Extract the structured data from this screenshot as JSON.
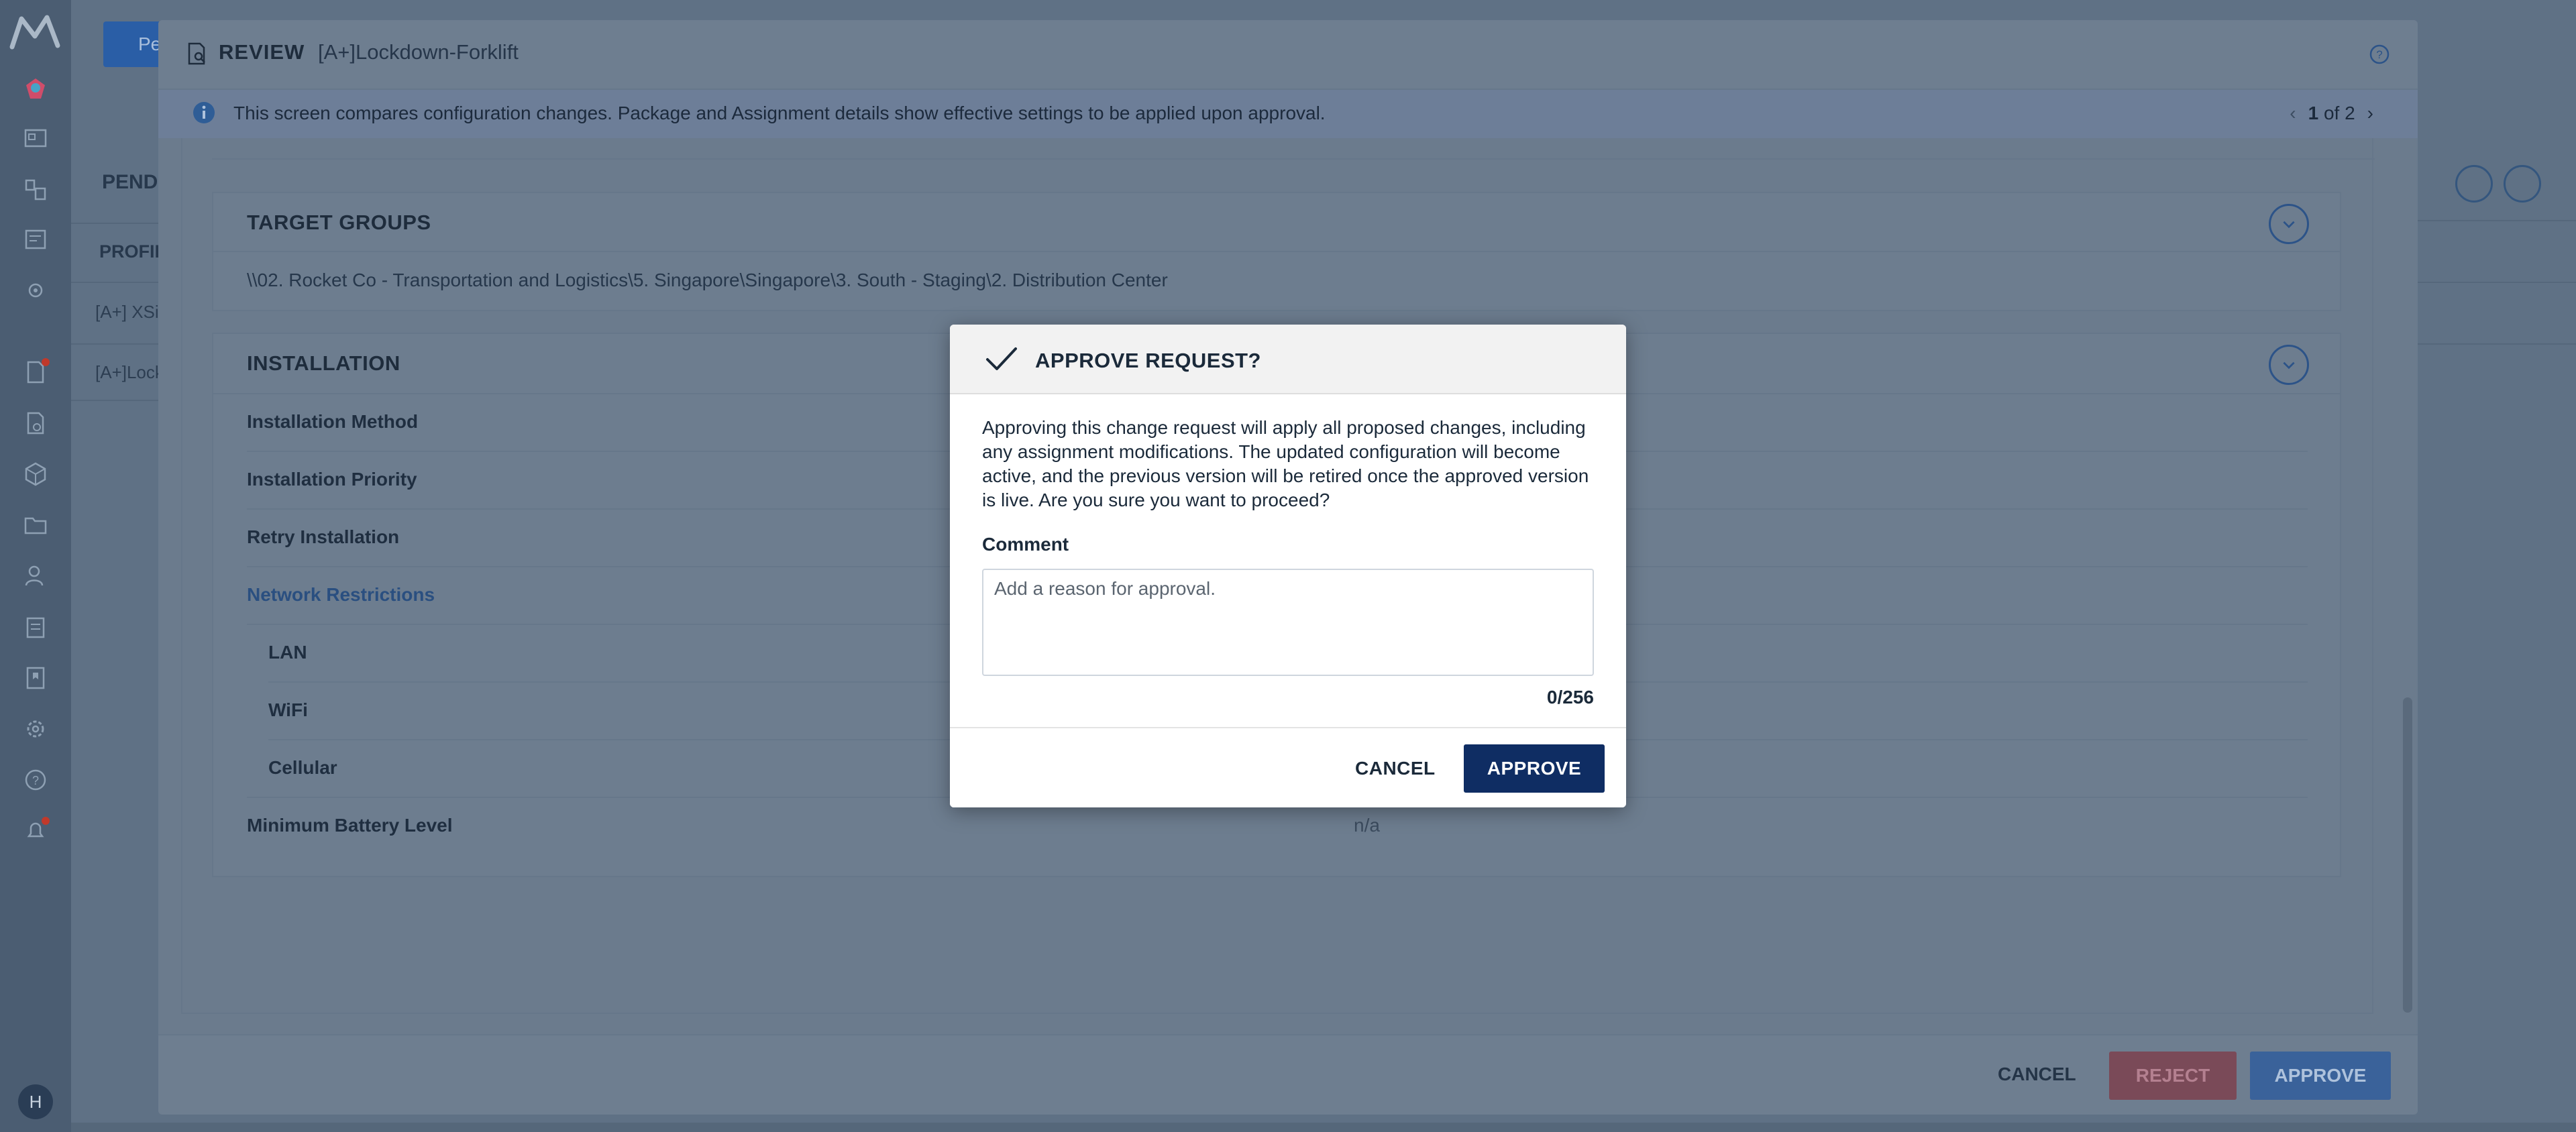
{
  "background": {
    "new_button_label": "Pe",
    "section_title": "PENDI",
    "column_header": "PROFIL",
    "rows": [
      "[A+] XSi",
      "[A+]Lock"
    ]
  },
  "review": {
    "title": "REVIEW",
    "name": "[A+]Lockdown-Forklift",
    "info_text": "This screen compares configuration changes. Package and Assignment details show effective settings to be applied upon approval.",
    "pager": {
      "current": "1",
      "of_label": "of 2"
    },
    "target_groups": {
      "title": "TARGET GROUPS",
      "path": "\\\\02. Rocket Co - Transportation and Logistics\\5. Singapore\\Singapore\\3. South - Staging\\2. Distribution Center"
    },
    "installation": {
      "title": "INSTALLATION",
      "rows": [
        {
          "label": "Installation Method"
        },
        {
          "label": "Installation Priority"
        },
        {
          "label": "Retry Installation"
        },
        {
          "label": "Network Restrictions"
        },
        {
          "label": "LAN"
        },
        {
          "label": "WiFi"
        },
        {
          "label": "Cellular"
        },
        {
          "label": "Minimum Battery Level",
          "value": "n/a"
        }
      ]
    },
    "footer": {
      "cancel": "CANCEL",
      "reject": "REJECT",
      "approve": "APPROVE"
    }
  },
  "dialog": {
    "title": "APPROVE REQUEST?",
    "message": "Approving this change request will apply all proposed changes, including any assignment modifications. The updated configuration will become active, and the previous version will be retired once the approved version is live. Are you sure you want to proceed?",
    "comment_label": "Comment",
    "comment_placeholder": "Add a reason for approval.",
    "comment_value": "",
    "char_count": "0/256",
    "cancel": "CANCEL",
    "approve": "APPROVE"
  },
  "nav": {
    "avatar_initial": "H",
    "icons": [
      "dashboard-icon",
      "devices-icon",
      "reports-icon",
      "settings-cog-icon",
      "alerts-doc-icon",
      "profiles-icon",
      "packages-icon",
      "folder-icon",
      "users-icon",
      "clipboard-icon",
      "bookmark-icon",
      "gear-icon",
      "help-icon",
      "notifications-icon"
    ]
  },
  "colors": {
    "primary": "#0f2d63",
    "reject": "#7a4a58",
    "link": "#2a4f80"
  }
}
